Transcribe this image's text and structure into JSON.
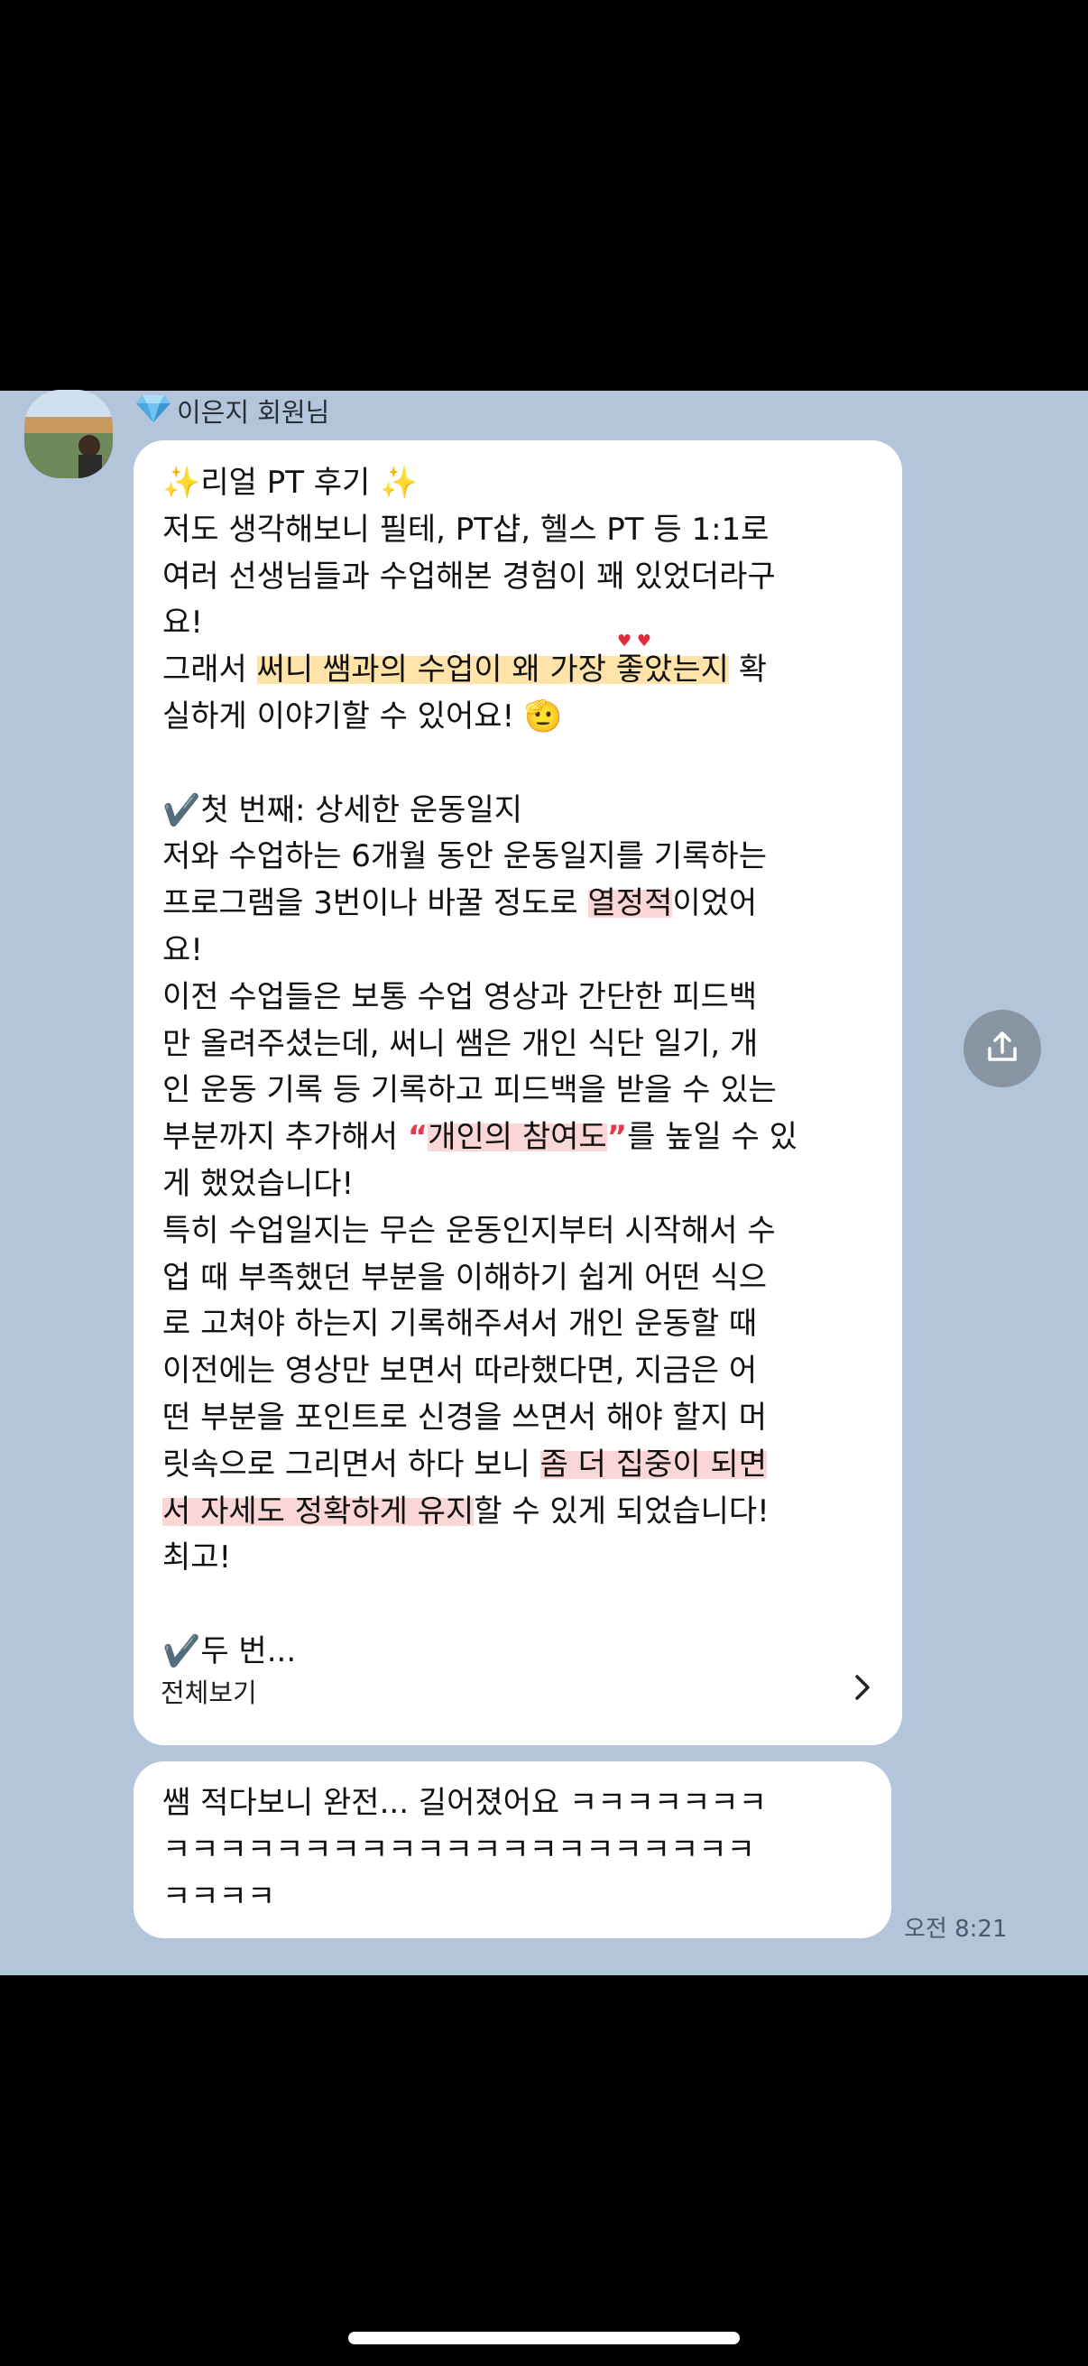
{
  "sender": {
    "badge_icon": "gem-icon",
    "name": "이은지 회원님"
  },
  "message1": {
    "lines": [
      [
        {
          "t": "✨리얼 PT 후기 ✨"
        }
      ],
      [
        {
          "t": "저도 생각해보니 필테, PT샵, 헬스 PT 등 1:1로"
        }
      ],
      [
        {
          "t": "여러 선생님들과 수업해본 경험이 꽤 있었더라구"
        }
      ],
      [
        {
          "t": "요!"
        }
      ],
      [
        {
          "t": "그래서 "
        },
        {
          "t": "써니 쌤과의 수업이 왜 가장 좋았는지",
          "hl": "y"
        },
        {
          "t": " 확"
        }
      ],
      [
        {
          "t": "실하게 이야기할 수 있어요! 🫡"
        }
      ],
      [
        {
          "t": ""
        }
      ],
      [
        {
          "t": "✔️첫 번째: 상세한 운동일지"
        }
      ],
      [
        {
          "t": "저와 수업하는 6개월 동안 운동일지를 기록하는"
        }
      ],
      [
        {
          "t": "프로그램을 3번이나 바꿀 정도로 "
        },
        {
          "t": "열정적",
          "hl": "p"
        },
        {
          "t": "이었어"
        }
      ],
      [
        {
          "t": "요!"
        }
      ],
      [
        {
          "t": "이전 수업들은 보통 수업 영상과 간단한 피드백"
        }
      ],
      [
        {
          "t": "만 올려주셨는데, 써니 쌤은 개인 식단 일기, 개"
        }
      ],
      [
        {
          "t": "인 운동 기록 등 기록하고 피드백을 받을 수 있는"
        }
      ],
      [
        {
          "t": "부분까지 추가해서 "
        },
        {
          "t": "“",
          "q": true
        },
        {
          "t": "개인의 참여도",
          "hl": "p"
        },
        {
          "t": "”",
          "q": true
        },
        {
          "t": "를 높일 수 있"
        }
      ],
      [
        {
          "t": "게 했었습니다!"
        }
      ],
      [
        {
          "t": "특히 수업일지는 무슨 운동인지부터 시작해서 수"
        }
      ],
      [
        {
          "t": "업 때 부족했던 부분을 이해하기 쉽게 어떤 식으"
        }
      ],
      [
        {
          "t": "로 고쳐야 하는지 기록해주셔서 개인 운동할 때"
        }
      ],
      [
        {
          "t": "이전에는 영상만 보면서 따라했다면, 지금은 어"
        }
      ],
      [
        {
          "t": "떤 부분을 포인트로 신경을 쓰면서 해야 할지 머"
        }
      ],
      [
        {
          "t": "릿속으로 그리면서 하다 보니 "
        },
        {
          "t": "좀 더 집중이 되면",
          "hl": "p"
        }
      ],
      [
        {
          "t": "서 자세도 정확하게 유지",
          "hl": "p"
        },
        {
          "t": "할 수 있게 되었습니다!"
        }
      ],
      [
        {
          "t": "최고!"
        }
      ],
      [
        {
          "t": ""
        }
      ],
      [
        {
          "t": "✔️두 번..."
        }
      ]
    ],
    "see_all_label": "전체보기"
  },
  "message2": {
    "lines": [
      "쌤 적다보니 완전... 길어졌어요 ㅋㅋㅋㅋㅋㅋㅋ",
      "ㅋㅋㅋㅋㅋㅋㅋㅋㅋㅋㅋㅋㅋㅋㅋㅋㅋㅋㅋㅋㅋ",
      "ㅋㅋㅋㅋ"
    ]
  },
  "timestamp": "오전 8:21",
  "share_button_icon": "share-icon"
}
